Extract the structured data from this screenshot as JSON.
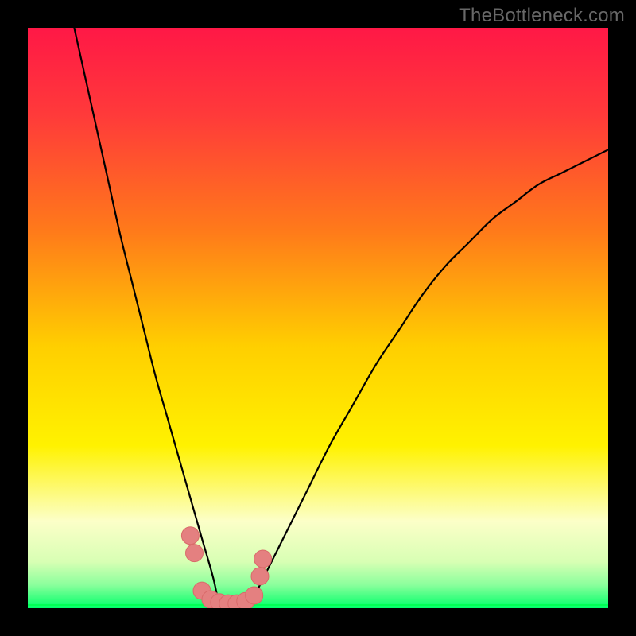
{
  "watermark": "TheBottleneck.com",
  "colors": {
    "black": "#000000",
    "curve": "#000000",
    "marker_fill": "#e48080",
    "marker_stroke": "#d96a6a",
    "green_line": "#00ff55"
  },
  "chart_data": {
    "type": "line",
    "title": "",
    "xlabel": "",
    "ylabel": "",
    "xlim": [
      0,
      100
    ],
    "ylim": [
      0,
      100
    ],
    "background_gradient": [
      {
        "stop": 0.0,
        "color": "#ff1846"
      },
      {
        "stop": 0.15,
        "color": "#ff3a3a"
      },
      {
        "stop": 0.35,
        "color": "#ff7a1a"
      },
      {
        "stop": 0.55,
        "color": "#ffcf00"
      },
      {
        "stop": 0.72,
        "color": "#fff200"
      },
      {
        "stop": 0.85,
        "color": "#fcffc8"
      },
      {
        "stop": 0.92,
        "color": "#d8ffb4"
      },
      {
        "stop": 0.96,
        "color": "#8aff9c"
      },
      {
        "stop": 1.0,
        "color": "#00ff6a"
      }
    ],
    "series": [
      {
        "name": "left_branch",
        "x": [
          8,
          10,
          12,
          14,
          16,
          18,
          20,
          22,
          24,
          26,
          28,
          30,
          32,
          33
        ],
        "y": [
          100,
          91,
          82,
          73,
          64,
          56,
          48,
          40,
          33,
          26,
          19,
          12,
          5,
          0
        ]
      },
      {
        "name": "right_branch",
        "x": [
          38,
          40,
          44,
          48,
          52,
          56,
          60,
          64,
          68,
          72,
          76,
          80,
          84,
          88,
          92,
          96,
          100
        ],
        "y": [
          0,
          4,
          12,
          20,
          28,
          35,
          42,
          48,
          54,
          59,
          63,
          67,
          70,
          73,
          75,
          77,
          79
        ]
      }
    ],
    "markers": {
      "name": "highlight_points",
      "points": [
        {
          "x": 28.0,
          "y": 12.5
        },
        {
          "x": 28.7,
          "y": 9.5
        },
        {
          "x": 30.0,
          "y": 3.0
        },
        {
          "x": 31.5,
          "y": 1.5
        },
        {
          "x": 33.0,
          "y": 1.0
        },
        {
          "x": 34.5,
          "y": 0.8
        },
        {
          "x": 36.0,
          "y": 0.8
        },
        {
          "x": 37.5,
          "y": 1.2
        },
        {
          "x": 39.0,
          "y": 2.2
        },
        {
          "x": 40.0,
          "y": 5.5
        },
        {
          "x": 40.5,
          "y": 8.5
        }
      ]
    }
  }
}
